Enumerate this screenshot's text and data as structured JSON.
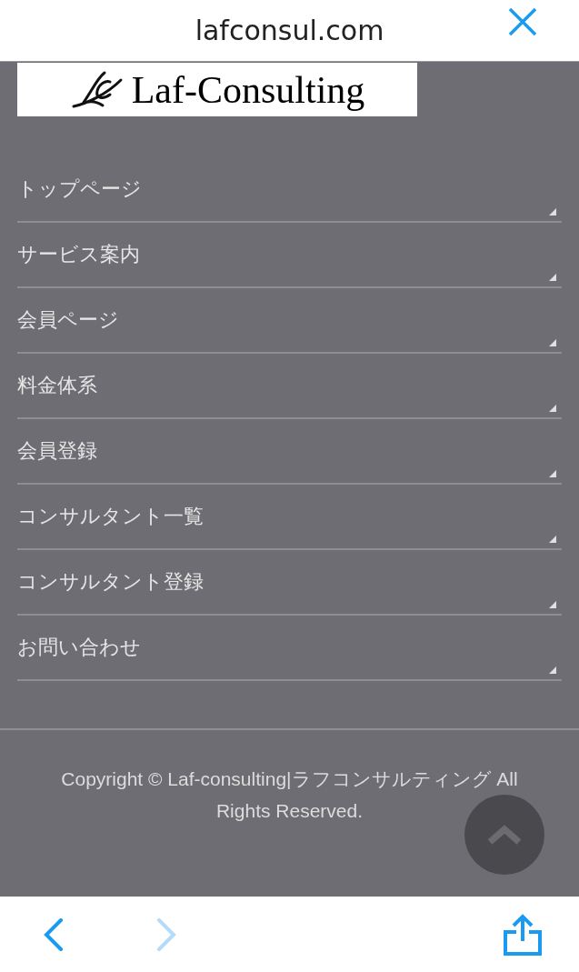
{
  "browser_bar": {
    "title": "lafconsul.com"
  },
  "logo": {
    "name": "Laf-Consulting"
  },
  "menu": [
    {
      "label": "トップページ"
    },
    {
      "label": "サービス案内"
    },
    {
      "label": "会員ページ"
    },
    {
      "label": "料金体系"
    },
    {
      "label": "会員登録"
    },
    {
      "label": "コンサルタント一覧"
    },
    {
      "label": "コンサルタント登録"
    },
    {
      "label": "お問い合わせ"
    }
  ],
  "footer": {
    "copyright": "Copyright © Laf-consulting|ラフコンサルティング All Rights Reserved."
  },
  "toolbar": {
    "back": {
      "disabled": false
    },
    "forward": {
      "disabled": true
    }
  }
}
